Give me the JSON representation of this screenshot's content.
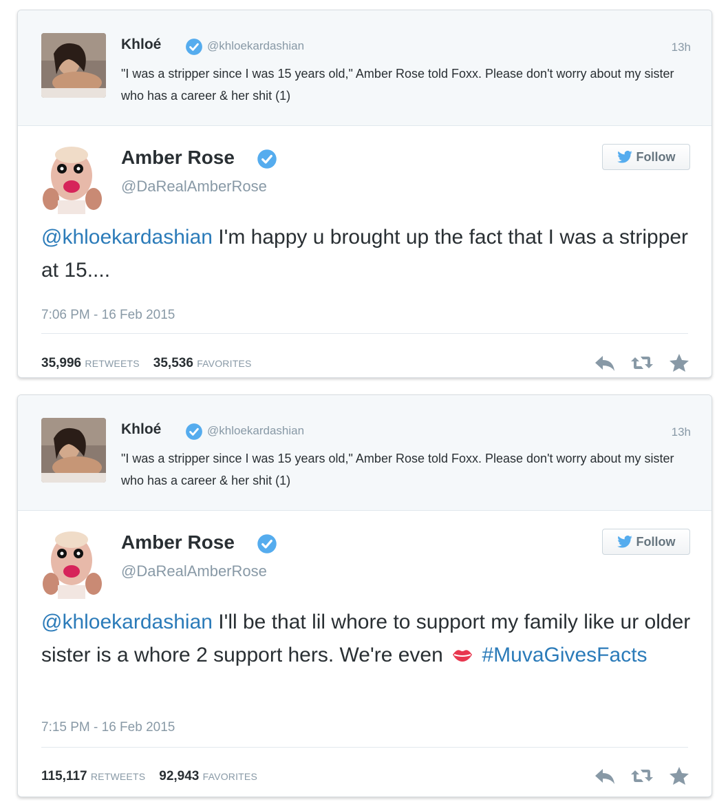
{
  "colors": {
    "link": "#2b7bb9",
    "verified": "#55acee",
    "muted": "#8899a6",
    "text": "#292f33",
    "parent_bg": "#f5f8fa",
    "lips": "#e8374f"
  },
  "tweets": [
    {
      "parent": {
        "name": "Khloé",
        "handle": "@khloekardashian",
        "time": "13h",
        "text": "\"I was a stripper since I was 15 years old,\" Amber Rose told Foxx. Please don't worry about my sister who has a career & her shit (1)",
        "avatar_icon": "photo-avatar"
      },
      "main": {
        "name": "Amber Rose",
        "handle": "@DaRealAmberRose",
        "follow_label": "Follow",
        "mention": "@khloekardashian",
        "text": " I'm happy u brought up the fact that I was a stripper at 15....",
        "timestamp": "7:06 PM - 16 Feb 2015",
        "retweets": "35,996",
        "retweets_label": "RETWEETS",
        "favorites": "35,536",
        "favorites_label": "FAVORITES"
      }
    },
    {
      "parent": {
        "name": "Khloé",
        "handle": "@khloekardashian",
        "time": "13h",
        "text": "\"I was a stripper since I was 15 years old,\" Amber Rose told Foxx. Please don't worry about my sister who has a career & her shit (1)",
        "avatar_icon": "photo-avatar"
      },
      "main": {
        "name": "Amber Rose",
        "handle": "@DaRealAmberRose",
        "follow_label": "Follow",
        "mention": "@khloekardashian",
        "text": " I'll be that lil whore to support my family like ur older sister is a whore 2 support hers. We're even ",
        "emoji_icon": "kiss-lips-icon",
        "hashtag": "#MuvaGivesFacts",
        "timestamp": "7:15 PM - 16 Feb 2015",
        "retweets": "115,117",
        "retweets_label": "RETWEETS",
        "favorites": "92,943",
        "favorites_label": "FAVORITES"
      }
    }
  ],
  "icons": [
    "verified-badge-icon",
    "twitter-bird-icon",
    "reply-icon",
    "retweet-icon",
    "favorite-star-icon"
  ]
}
